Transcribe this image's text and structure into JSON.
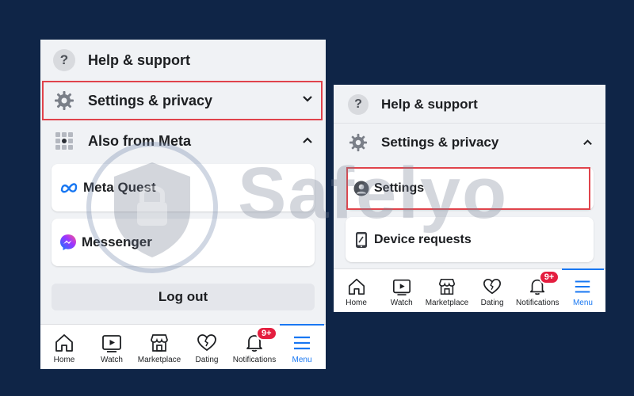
{
  "left_panel": {
    "help": {
      "label": "Help & support",
      "icon": "question-icon"
    },
    "settings": {
      "label": "Settings & privacy",
      "icon": "gear-icon",
      "chevron": "chevron-down-icon"
    },
    "also_meta": {
      "label": "Also from Meta",
      "icon": "grid-icon",
      "chevron": "chevron-up-icon"
    },
    "cards": [
      {
        "label": "Meta Quest",
        "icon": "meta-logo-icon"
      },
      {
        "label": "Messenger",
        "icon": "messenger-icon"
      }
    ],
    "logout_label": "Log out"
  },
  "right_panel": {
    "help": {
      "label": "Help & support",
      "icon": "question-icon"
    },
    "settings": {
      "label": "Settings & privacy",
      "icon": "gear-icon",
      "chevron": "chevron-up-icon"
    },
    "cards": [
      {
        "label": "Settings",
        "icon": "profile-icon"
      },
      {
        "label": "Device requests",
        "icon": "phone-icon"
      }
    ]
  },
  "tabbar": {
    "tabs": [
      {
        "label": "Home",
        "icon": "home-icon"
      },
      {
        "label": "Watch",
        "icon": "watch-icon"
      },
      {
        "label": "Marketplace",
        "icon": "marketplace-icon"
      },
      {
        "label": "Dating",
        "icon": "dating-icon"
      },
      {
        "label": "Notifications",
        "icon": "bell-icon",
        "badge": "9+"
      },
      {
        "label": "Menu",
        "icon": "menu-icon",
        "active": true
      }
    ]
  },
  "watermark": {
    "text": "Safelyo"
  },
  "colors": {
    "background": "#0f2547",
    "highlight": "#e0434b",
    "accent": "#1877f2",
    "badge": "#e41e3f"
  }
}
